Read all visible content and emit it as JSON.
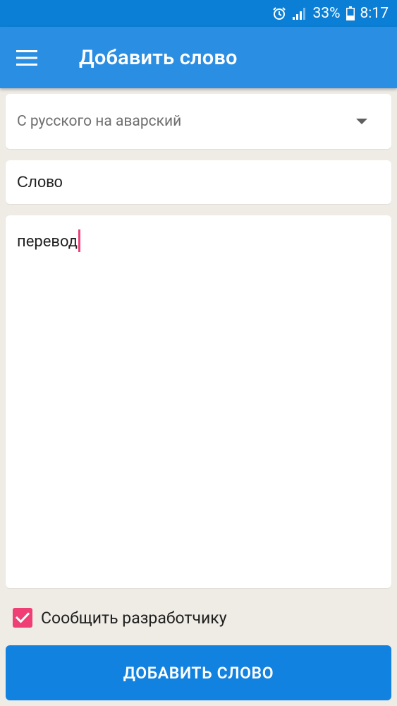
{
  "status_bar": {
    "battery_percent": "33%",
    "time": "8:17",
    "icons": [
      "alarm-icon",
      "signal-icon",
      "battery-icon"
    ]
  },
  "app_bar": {
    "title": "Добавить слово",
    "menu_icon": "hamburger-menu-icon"
  },
  "form": {
    "direction_select": {
      "selected": "С русского на аварский"
    },
    "word_field": {
      "placeholder": "Слово",
      "value": ""
    },
    "translation_field": {
      "value": "перевод"
    },
    "notify_checkbox": {
      "label": "Сообщить разработчику",
      "checked": true
    },
    "submit_label": "ДОБАВИТЬ СЛОВО"
  },
  "colors": {
    "status_bar": "#0b7fd6",
    "app_bar": "#2a8ee2",
    "background": "#efebe5",
    "accent": "#ef3f74",
    "button": "#1282e0"
  }
}
